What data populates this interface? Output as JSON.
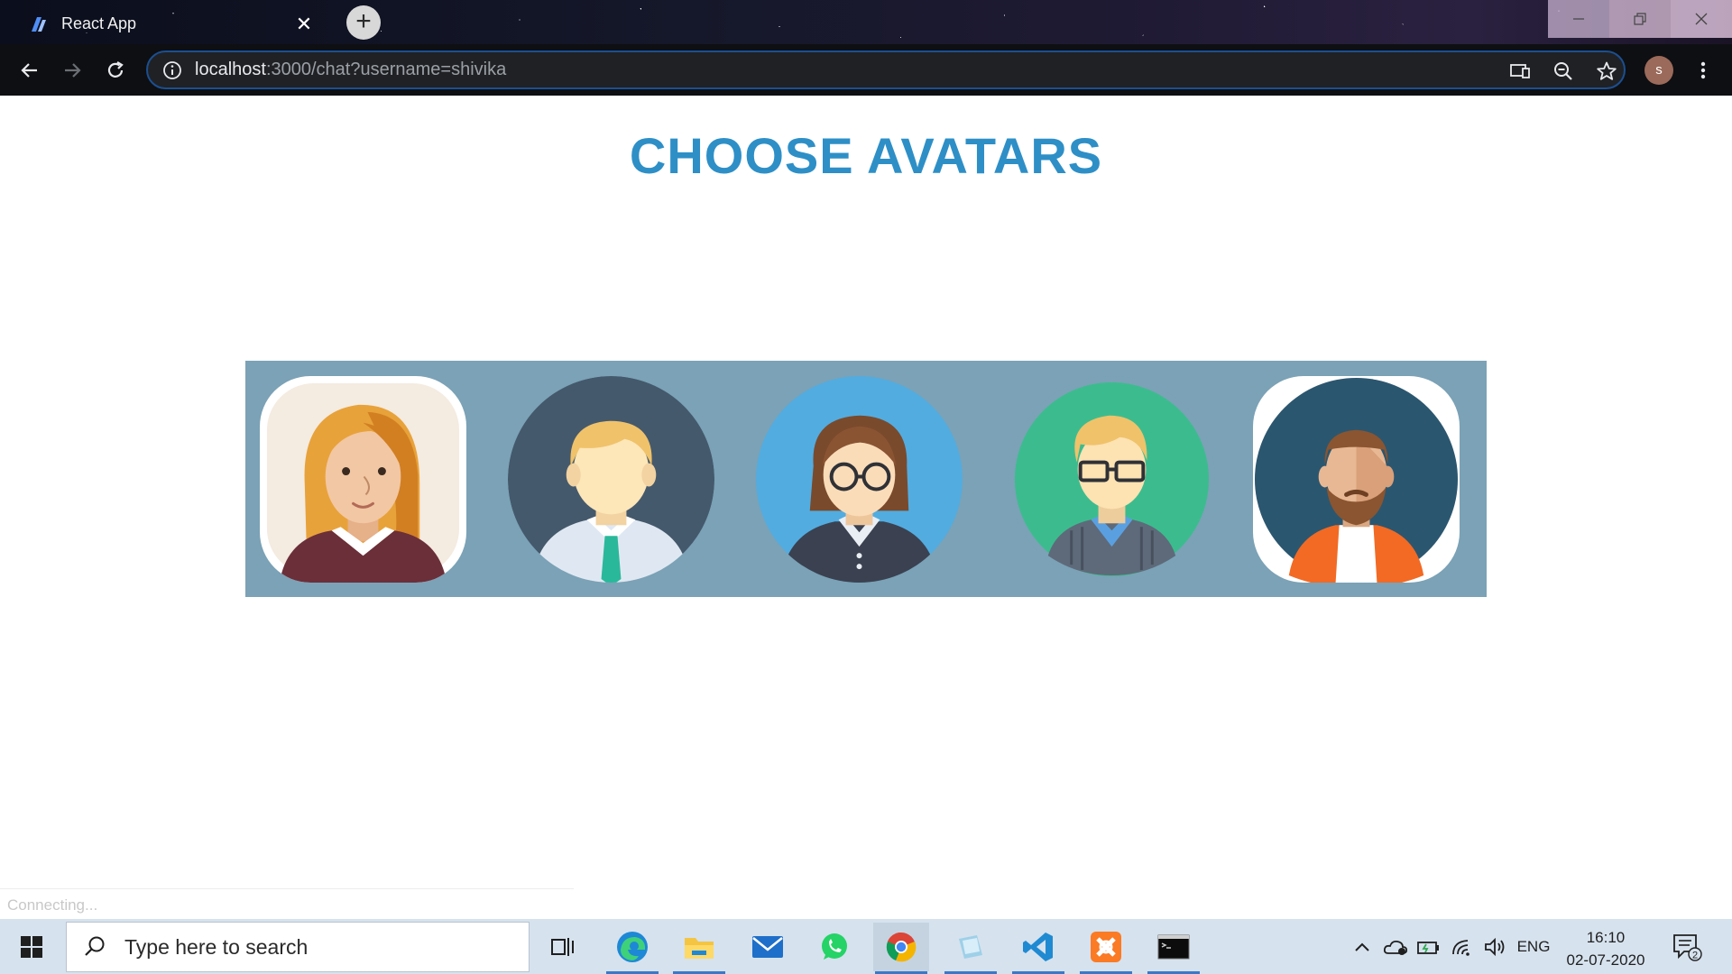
{
  "browser": {
    "tab_title": "React App",
    "new_tab_symbol": "+",
    "url_host": "localhost",
    "url_rest": ":3000/chat?username=shivika",
    "profile_initial": "s",
    "window_controls": [
      "minimize",
      "maximize",
      "close"
    ]
  },
  "page": {
    "title": "CHOOSE AVATARS",
    "avatars": [
      {
        "id": "avatar-1",
        "description": "woman-orange-hair"
      },
      {
        "id": "avatar-2",
        "description": "man-blonde-tie"
      },
      {
        "id": "avatar-3",
        "description": "woman-glasses"
      },
      {
        "id": "avatar-4",
        "description": "man-glasses-vest"
      },
      {
        "id": "avatar-5",
        "description": "man-beard"
      }
    ],
    "status_text": "Connecting..."
  },
  "taskbar": {
    "search_placeholder": "Type here to search",
    "apps": [
      "task-view",
      "edge",
      "file-explorer",
      "mail",
      "whatsapp",
      "chrome",
      "notepad",
      "vscode",
      "xampp",
      "terminal"
    ],
    "language": "ENG",
    "time": "16:10",
    "date": "02-07-2020",
    "notification_count": "2"
  },
  "colors": {
    "title": "#2e8fc7",
    "avatar_strip_bg": "#7ba2b6",
    "taskbar_bg": "#d6e2ee"
  }
}
